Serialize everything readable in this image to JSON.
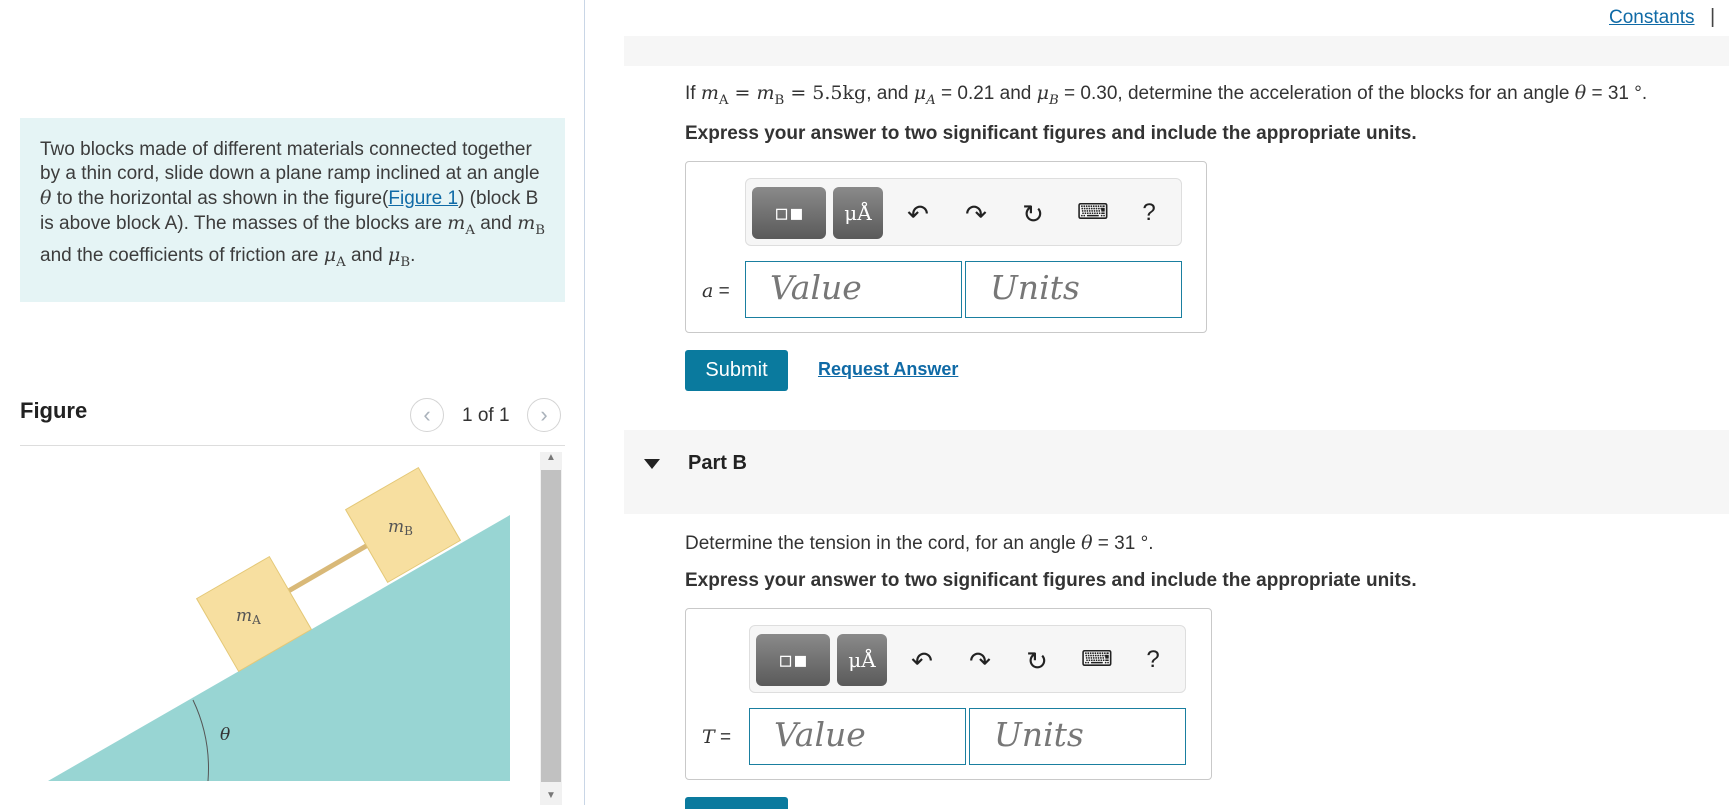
{
  "problem": {
    "text_1": "Two blocks made of different materials connected together by a thin cord, slide down a plane ramp inclined at an angle ",
    "theta": "θ",
    "text_2": " to the horizontal as shown in the figure(",
    "figure_link": "Figure 1",
    "text_3": ") (block B is above block A). The masses of the blocks are ",
    "m_A": "m",
    "sub_A": "A",
    "and_1": " and ",
    "m_B": "m",
    "sub_B": "B",
    "text_4": " and the coefficients of friction are ",
    "mu_A": "μ",
    "mu_sub_A": "A",
    "and_2": " and ",
    "mu_B": "μ",
    "mu_sub_B": "B",
    "period": "."
  },
  "figure": {
    "title": "Figure",
    "pager": "1 of 1",
    "prev_icon": "chevron-left-icon",
    "next_icon": "chevron-right-icon",
    "label_mA": "m",
    "label_mA_sub": "A",
    "label_mB": "m",
    "label_mB_sub": "B",
    "label_theta": "θ",
    "colors": {
      "ramp": "#98d5d3",
      "block": "#f7dfa0",
      "block_edge": "#e4c877",
      "cord": "#d9b978"
    }
  },
  "header": {
    "constants_link": "Constants",
    "separator": "|"
  },
  "part_a": {
    "q_prefix": "If ",
    "q_mA": "m",
    "q_mA_sub": "A",
    "q_eq1": " = ",
    "q_mB": "m",
    "q_mB_sub": "B",
    "q_eq2": " = 5.5kg",
    "q_mid": ", and ",
    "q_muA": "μ",
    "q_muA_sub": "A",
    "q_muA_val": " = 0.21 and ",
    "q_muB": "μ",
    "q_muB_sub": "B",
    "q_suffix": " = 0.30, determine the acceleration of the blocks for an angle ",
    "q_theta": "θ",
    "q_angle": " = 31 °.",
    "instructions": "Express your answer to two significant figures and include the appropriate units.",
    "var_label": "a",
    "var_eq": " =",
    "value_placeholder": "Value",
    "units_placeholder": "Units",
    "submit_label": "Submit",
    "request_label": "Request Answer"
  },
  "toolbar": {
    "units_glyph": "μÅ",
    "undo_icon": "undo-icon",
    "redo_icon": "redo-icon",
    "reset_icon": "reset-icon",
    "keyboard_icon": "keyboard-icon",
    "help_label": "?"
  },
  "part_b": {
    "title": "Part B",
    "q_prefix": "Determine the tension in the cord, for an angle ",
    "q_theta": "θ",
    "q_angle": " = 31 °.",
    "instructions": "Express your answer to two significant figures and include the appropriate units.",
    "var_label": "T",
    "var_eq": " =",
    "value_placeholder": "Value",
    "units_placeholder": "Units"
  }
}
